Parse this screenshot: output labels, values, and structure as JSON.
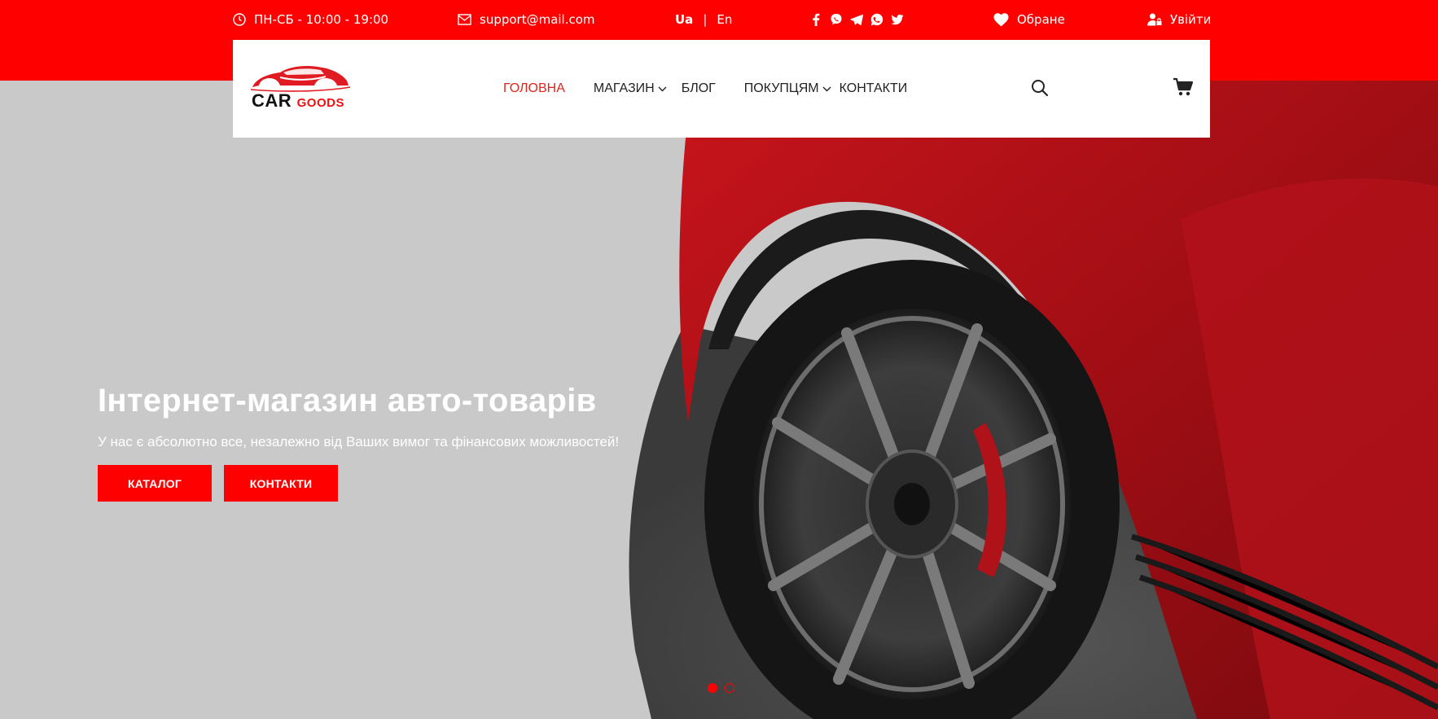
{
  "topbar": {
    "hours": "ПН-СБ - 10:00 - 19:00",
    "email": "support@mail.com",
    "lang_ua": "Ua",
    "lang_sep": "|",
    "lang_en": "En",
    "favorites": "Обране",
    "login": "Увійти",
    "social_icons": [
      "facebook-icon",
      "viber-icon",
      "telegram-icon",
      "whatsapp-icon",
      "twitter-icon"
    ]
  },
  "header": {
    "logo_car": "CAR",
    "logo_goods": "GOODS",
    "nav": [
      {
        "label": "ГОЛОВНА",
        "active": true
      },
      {
        "label": "МАГАЗИН",
        "dropdown": true
      },
      {
        "label": "БЛОГ"
      },
      {
        "label": "ПОКУПЦЯМ",
        "dropdown": true
      },
      {
        "label": "КОНТАКТИ"
      }
    ]
  },
  "hero": {
    "title": "Інтернет-магазин авто-товарів",
    "subtitle": "У нас є абсолютно все, незалежно від Ваших вимог та фінансових можливостей!",
    "btn_catalog": "КАТАЛОГ",
    "btn_contacts": "КОНТАКТИ",
    "slides": 2,
    "active_slide": 1
  },
  "colors": {
    "brand": "#ff0000",
    "nav_active": "#e0241b",
    "hero_bg": "#c8c8c8"
  }
}
